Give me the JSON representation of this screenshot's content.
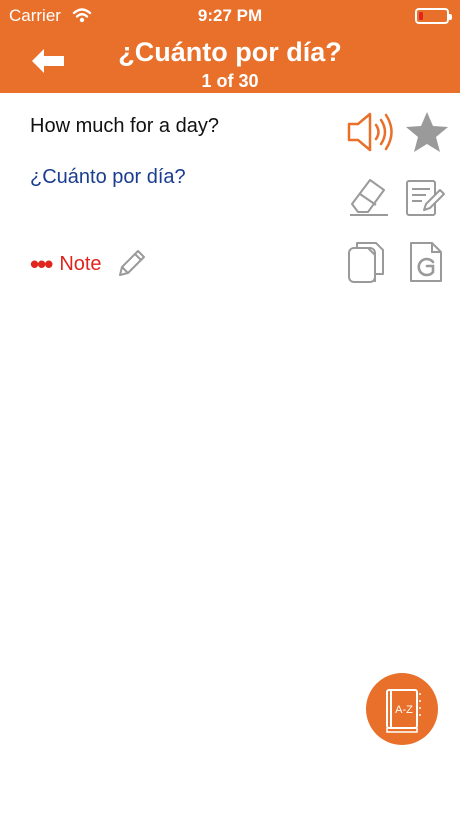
{
  "status_bar": {
    "carrier": "Carrier",
    "time": "9:27 PM"
  },
  "header": {
    "title": "¿Cuánto por día?",
    "subtitle": "1 of 30"
  },
  "phrase": {
    "english": "How much for a day?",
    "spanish": "¿Cuánto por día?"
  },
  "note": {
    "label": "Note",
    "dots": "•••"
  },
  "icons": [
    "back-arrow-icon",
    "speaker-icon",
    "star-icon",
    "eraser-icon",
    "edit-note-icon",
    "copy-icon",
    "google-icon",
    "dictionary-az-icon"
  ],
  "fab": {
    "label": "A-Z"
  },
  "colors": {
    "accent": "#E8702A",
    "spanish_text": "#1A3D8F",
    "note_red": "#E0241E",
    "icon_gray": "#9A9A9A"
  }
}
